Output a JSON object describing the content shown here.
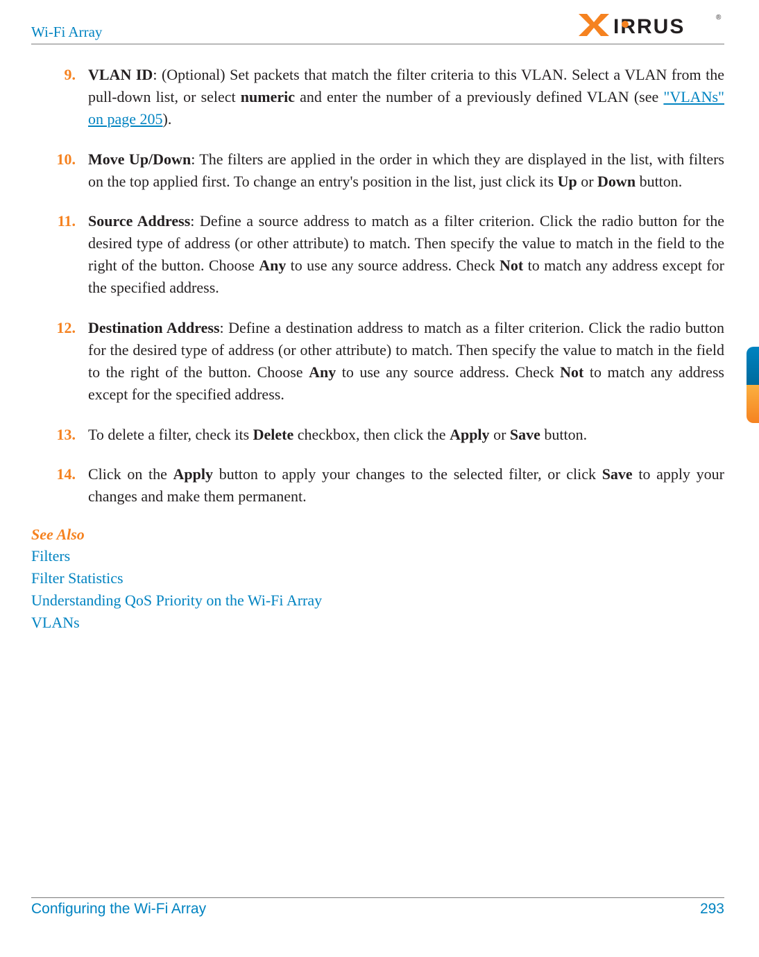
{
  "header": {
    "left": "Wi-Fi Array",
    "logo_text_bold": "X",
    "logo_text_rest": "RRUS",
    "logo_r": "®"
  },
  "items": [
    {
      "num": "9.",
      "segments": [
        {
          "t": "VLAN ID",
          "b": true
        },
        {
          "t": ": (Optional) Set packets that match the filter criteria to this VLAN. Select a VLAN from the pull-down list, or select "
        },
        {
          "t": "numeric",
          "b": true
        },
        {
          "t": " and enter the number of a previously defined VLAN (see "
        },
        {
          "t": "\"VLANs\" on page 205",
          "link": true
        },
        {
          "t": ")."
        }
      ]
    },
    {
      "num": "10.",
      "segments": [
        {
          "t": "Move Up/Down",
          "b": true
        },
        {
          "t": ": The filters are applied in the order in which they are displayed in the list, with filters on the top applied first. To change an entry's position in the list, just click its "
        },
        {
          "t": "Up",
          "b": true
        },
        {
          "t": " or "
        },
        {
          "t": "Down",
          "b": true
        },
        {
          "t": " button."
        }
      ]
    },
    {
      "num": "11.",
      "segments": [
        {
          "t": "Source Address",
          "b": true
        },
        {
          "t": ": Define a source address to match as a filter criterion. Click the radio button for the desired type of address (or other attribute) to match. Then specify the value to match in the field to the right of the button. Choose "
        },
        {
          "t": "Any",
          "b": true
        },
        {
          "t": " to use any source address. Check "
        },
        {
          "t": "Not",
          "b": true
        },
        {
          "t": " to match any address except for the specified address."
        }
      ]
    },
    {
      "num": "12.",
      "segments": [
        {
          "t": "Destination Address",
          "b": true
        },
        {
          "t": ": Define a destination address to match as a filter criterion. Click the radio button for the desired type of address (or other attribute) to match. Then specify the value to match in the field to the right of the button. Choose "
        },
        {
          "t": "Any",
          "b": true
        },
        {
          "t": " to use any source address. Check "
        },
        {
          "t": "Not",
          "b": true
        },
        {
          "t": " to match any address except for the specified address."
        }
      ]
    },
    {
      "num": "13.",
      "segments": [
        {
          "t": "To delete a filter, check its "
        },
        {
          "t": "Delete",
          "b": true
        },
        {
          "t": " checkbox, then click the "
        },
        {
          "t": "Apply",
          "b": true
        },
        {
          "t": " or "
        },
        {
          "t": "Save",
          "b": true
        },
        {
          "t": " button."
        }
      ]
    },
    {
      "num": "14.",
      "segments": [
        {
          "t": "Click on the "
        },
        {
          "t": "Apply",
          "b": true
        },
        {
          "t": " button to apply your changes to the selected filter, or click "
        },
        {
          "t": "Save",
          "b": true
        },
        {
          "t": " to apply your changes and make them permanent."
        }
      ]
    }
  ],
  "see_also": {
    "heading": "See Also",
    "links": [
      "Filters",
      "Filter Statistics",
      "Understanding QoS Priority on the Wi-Fi Array",
      "VLANs"
    ]
  },
  "footer": {
    "left": "Configuring the Wi-Fi Array",
    "right": "293"
  }
}
